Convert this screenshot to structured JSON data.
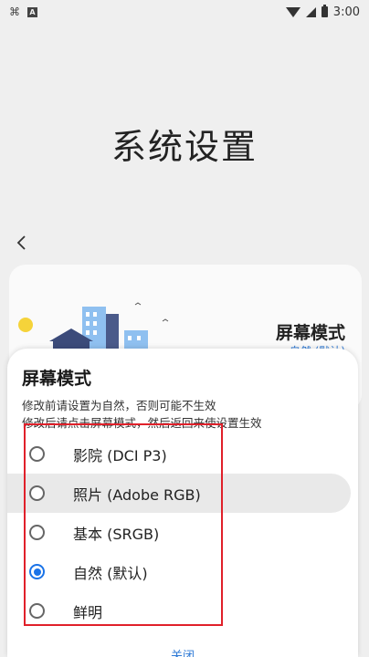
{
  "status_bar": {
    "time": "3:00",
    "left_icons": [
      "app-notification-icon",
      "a-box-icon"
    ],
    "right_icons": [
      "wifi-icon",
      "signal-icon",
      "battery-icon"
    ]
  },
  "page": {
    "title": "系统设置"
  },
  "background_card": {
    "title": "屏幕模式",
    "subtitle": "自然 (默认)"
  },
  "dialog": {
    "title": "屏幕模式",
    "note_1": "修改前请设置为自然，否则可能不生效",
    "note_2": "修改后请点击屏幕模式，然后返回来使设置生效",
    "options": [
      {
        "label": "影院 (DCI P3)",
        "checked": false
      },
      {
        "label": "照片 (Adobe RGB)",
        "checked": false
      },
      {
        "label": "基本 (SRGB)",
        "checked": false
      },
      {
        "label": "自然 (默认)",
        "checked": true
      },
      {
        "label": "鲜明",
        "checked": false
      }
    ],
    "close_label": "关闭"
  },
  "colors": {
    "accent": "#1a73e8",
    "link": "#2e7ad6",
    "highlight_box": "#e0202a"
  }
}
